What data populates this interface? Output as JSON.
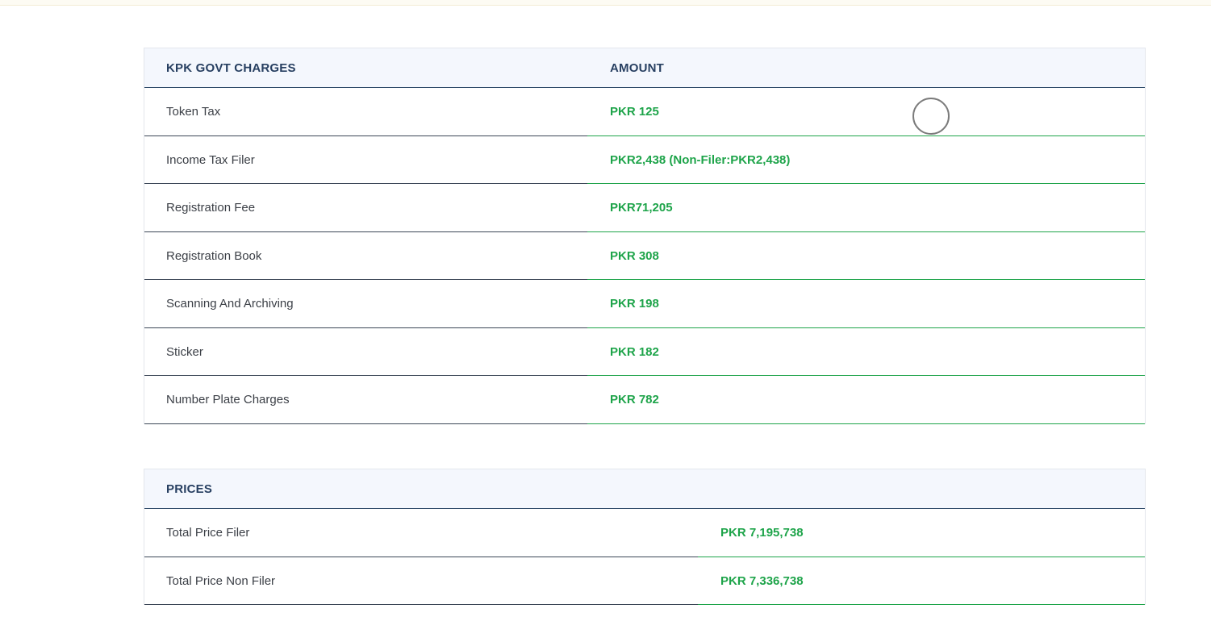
{
  "charges": {
    "header": {
      "col1": "KPK GOVT CHARGES",
      "col2": "AMOUNT"
    },
    "rows": [
      {
        "label": "Token Tax",
        "value": "PKR 125"
      },
      {
        "label": "Income Tax Filer",
        "value": "PKR2,438 (Non-Filer:PKR2,438)"
      },
      {
        "label": "Registration Fee",
        "value": "PKR71,205"
      },
      {
        "label": "Registration Book",
        "value": "PKR 308"
      },
      {
        "label": "Scanning And Archiving",
        "value": "PKR 198"
      },
      {
        "label": "Sticker",
        "value": "PKR 182"
      },
      {
        "label": "Number Plate Charges",
        "value": "PKR 782"
      }
    ]
  },
  "prices": {
    "header": {
      "col1": "PRICES"
    },
    "rows": [
      {
        "label": "Total Price Filer",
        "value": "PKR 7,195,738"
      },
      {
        "label": "Total Price Non Filer",
        "value": "PKR 7,336,738"
      }
    ]
  },
  "colors": {
    "header_bg": "#f4f7fd",
    "header_text": "#273f61",
    "value_green": "#1ea44a",
    "label_text": "#3b3f46"
  }
}
